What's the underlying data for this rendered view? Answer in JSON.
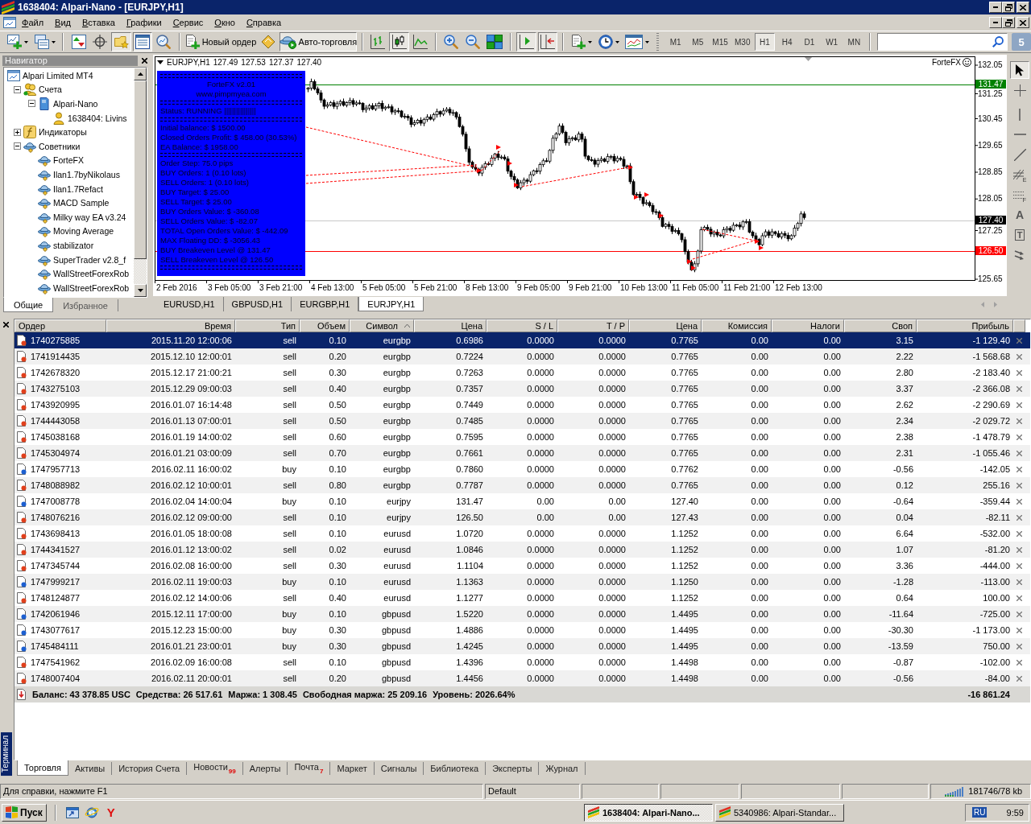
{
  "window": {
    "title": "1638404: Alpari-Nano - [EURJPY,H1]"
  },
  "menu": [
    "Файл",
    "Вид",
    "Вставка",
    "Графики",
    "Сервис",
    "Окно",
    "Справка"
  ],
  "toolbar": {
    "groups": [
      [
        {
          "kind": "newchart",
          "pressed": false
        },
        {
          "kind": "profiles",
          "pressed": false
        }
      ],
      [
        {
          "kind": "marketwatch",
          "pressed": false
        },
        {
          "kind": "datawindow",
          "pressed": false
        },
        {
          "kind": "navigator",
          "pressed": true
        },
        {
          "kind": "terminal",
          "pressed": true
        },
        {
          "kind": "tester",
          "pressed": false
        }
      ],
      [
        {
          "kind": "neworder",
          "label": "Новый ордер",
          "pressed": false
        },
        {
          "kind": "metaeditor",
          "pressed": false
        },
        {
          "kind": "autotrading",
          "label": "Авто-торговля",
          "pressed": true
        }
      ],
      [
        {
          "kind": "barchart",
          "pressed": false
        },
        {
          "kind": "candles",
          "pressed": true
        },
        {
          "kind": "linechart",
          "pressed": false
        }
      ],
      [
        {
          "kind": "zoomin",
          "pressed": false
        },
        {
          "kind": "zoomout",
          "pressed": false
        },
        {
          "kind": "tile",
          "pressed": false
        }
      ],
      [
        {
          "kind": "autoscroll",
          "pressed": true
        },
        {
          "kind": "chartshift",
          "pressed": true
        }
      ],
      [
        {
          "kind": "indicators",
          "pressed": false
        },
        {
          "kind": "periods",
          "pressed": false
        },
        {
          "kind": "templates",
          "pressed": false
        }
      ]
    ],
    "timeframes": [
      {
        "label": "M1",
        "selected": false
      },
      {
        "label": "M5",
        "selected": false
      },
      {
        "label": "M15",
        "selected": false
      },
      {
        "label": "M30",
        "selected": false
      },
      {
        "label": "H1",
        "selected": true
      },
      {
        "label": "H4",
        "selected": false
      },
      {
        "label": "D1",
        "selected": false
      },
      {
        "label": "W1",
        "selected": false
      },
      {
        "label": "MN",
        "selected": false
      }
    ],
    "notifications": "5"
  },
  "navigator": {
    "title": "Навигатор",
    "tree": [
      {
        "label": "Alpari Limited MT4",
        "kind": "terminal",
        "children": [
          {
            "label": "Счета",
            "kind": "accounts",
            "expanded": true,
            "children": [
              {
                "label": "Alpari-Nano",
                "kind": "server",
                "expanded": true,
                "children": [
                  {
                    "label": "1638404: Livins",
                    "kind": "account"
                  }
                ]
              }
            ]
          },
          {
            "label": "Индикаторы",
            "kind": "indicators",
            "expanded": false
          },
          {
            "label": "Советники",
            "kind": "experts",
            "expanded": true,
            "children": [
              {
                "label": "ForteFX",
                "kind": "expert"
              },
              {
                "label": "Ilan1.7byNikolaus",
                "kind": "expert"
              },
              {
                "label": "Ilan1.7Refact",
                "kind": "expert"
              },
              {
                "label": "MACD Sample",
                "kind": "expert"
              },
              {
                "label": "Milky way EA v3.24",
                "kind": "expert"
              },
              {
                "label": "Moving Average",
                "kind": "expert"
              },
              {
                "label": "stabilizator",
                "kind": "expert"
              },
              {
                "label": "SuperTrader v2.8_f",
                "kind": "expert"
              },
              {
                "label": "WallStreetForexRob",
                "kind": "expert"
              },
              {
                "label": "WallStreetForexRob",
                "kind": "expert"
              }
            ]
          }
        ]
      }
    ],
    "tabs": [
      {
        "label": "Общие",
        "selected": true
      },
      {
        "label": "Избранное",
        "selected": false
      }
    ]
  },
  "chart": {
    "symbol": "EURJPY,H1",
    "ohlc": [
      "127.49",
      "127.53",
      "127.37",
      "127.40"
    ],
    "expert": "ForteFX",
    "price_axis": [
      "132.05",
      "131.25",
      "130.45",
      "129.65",
      "128.85",
      "128.05",
      "127.25",
      "125.65"
    ],
    "price_lines": [
      {
        "label": "131.47",
        "kind": "buy",
        "color": "#008000"
      },
      {
        "label": "127.40",
        "kind": "bid",
        "color": "#000000"
      },
      {
        "label": "126.50",
        "kind": "sell",
        "color": "#ff0000"
      }
    ],
    "time_axis": [
      "2 Feb 2016",
      "3 Feb 05:00",
      "3 Feb 21:00",
      "4 Feb 13:00",
      "5 Feb 05:00",
      "5 Feb 21:00",
      "8 Feb 13:00",
      "9 Feb 05:00",
      "9 Feb 21:00",
      "10 Feb 13:00",
      "11 Feb 05:00",
      "11 Feb 21:00",
      "12 Feb 13:00"
    ],
    "ea_panel": {
      "sections": [
        [
          "ForteFX v2.01",
          "www.pimpmyea.com"
        ],
        [
          "Status: RUNNING ||||||||||||||||"
        ],
        [
          "Initial balance: $ 1500.00",
          "Closed Orders Profit: $ 458.00 (30.53%)",
          "EA Balance: $ 1958.00"
        ],
        [
          "Order Step: 75.0 pips",
          "BUY Orders: 1 (0.10 lots)",
          "SELL Orders: 1 (0.10 lots)",
          "BUY Target: $ 25.00",
          "SELL Target: $ 25.00",
          "BUY Orders Value: $ -360.08",
          "SELL Orders Value: $ -82.07",
          "TOTAL Open Orders Value: $ -442.09",
          "MAX Floating DD: $ -3056.43",
          "BUY Breakeven Level @ 131.47",
          "SELL Breakeven Level @ 126.50"
        ]
      ]
    }
  },
  "chart_tabs": [
    {
      "label": "EURUSD,H1",
      "selected": false
    },
    {
      "label": "GBPUSD,H1",
      "selected": false
    },
    {
      "label": "EURGBP,H1",
      "selected": false
    },
    {
      "label": "EURJPY,H1",
      "selected": true
    }
  ],
  "chart_tools": [
    {
      "kind": "cursor",
      "pressed": true
    },
    {
      "kind": "crosshair",
      "pressed": false
    },
    {
      "kind": "vline",
      "pressed": false
    },
    {
      "kind": "hline",
      "pressed": false
    },
    {
      "kind": "trendline",
      "pressed": false
    },
    {
      "kind": "channel",
      "pressed": false,
      "glyph": "E"
    },
    {
      "kind": "fibo",
      "pressed": false,
      "glyph": "F"
    },
    {
      "kind": "text",
      "pressed": false,
      "glyph": "A"
    },
    {
      "kind": "label",
      "pressed": false,
      "glyph": "T"
    },
    {
      "kind": "arrows",
      "pressed": false
    }
  ],
  "terminal": {
    "label": "Терминал",
    "columns": [
      {
        "label": "Ордер",
        "sorted": false
      },
      {
        "label": "Время",
        "sorted": false
      },
      {
        "label": "Тип",
        "sorted": false
      },
      {
        "label": "Объем",
        "sorted": false
      },
      {
        "label": "Символ",
        "sorted": true
      },
      {
        "label": "Цена",
        "sorted": false
      },
      {
        "label": "S / L",
        "sorted": false
      },
      {
        "label": "T / P",
        "sorted": false
      },
      {
        "label": "Цена",
        "sorted": false
      },
      {
        "label": "Комиссия",
        "sorted": false
      },
      {
        "label": "Налоги",
        "sorted": false
      },
      {
        "label": "Своп",
        "sorted": false
      },
      {
        "label": "Прибыль",
        "sorted": false
      }
    ],
    "rows": [
      {
        "cells": [
          "1740275885",
          "2015.11.20 12:00:06",
          "sell",
          "0.10",
          "eurgbp",
          "0.6986",
          "0.0000",
          "0.0000",
          "0.7765",
          "0.00",
          "0.00",
          "3.15",
          "-1 129.40"
        ],
        "kind": "sell",
        "selected": true
      },
      {
        "cells": [
          "1741914435",
          "2015.12.10 12:00:01",
          "sell",
          "0.20",
          "eurgbp",
          "0.7224",
          "0.0000",
          "0.0000",
          "0.7765",
          "0.00",
          "0.00",
          "2.22",
          "-1 568.68"
        ],
        "kind": "sell",
        "selected": false
      },
      {
        "cells": [
          "1742678320",
          "2015.12.17 21:00:21",
          "sell",
          "0.30",
          "eurgbp",
          "0.7263",
          "0.0000",
          "0.0000",
          "0.7765",
          "0.00",
          "0.00",
          "2.80",
          "-2 183.40"
        ],
        "kind": "sell",
        "selected": false
      },
      {
        "cells": [
          "1743275103",
          "2015.12.29 09:00:03",
          "sell",
          "0.40",
          "eurgbp",
          "0.7357",
          "0.0000",
          "0.0000",
          "0.7765",
          "0.00",
          "0.00",
          "3.37",
          "-2 366.08"
        ],
        "kind": "sell",
        "selected": false
      },
      {
        "cells": [
          "1743920995",
          "2016.01.07 16:14:48",
          "sell",
          "0.50",
          "eurgbp",
          "0.7449",
          "0.0000",
          "0.0000",
          "0.7765",
          "0.00",
          "0.00",
          "2.62",
          "-2 290.69"
        ],
        "kind": "sell",
        "selected": false
      },
      {
        "cells": [
          "1744443058",
          "2016.01.13 07:00:01",
          "sell",
          "0.50",
          "eurgbp",
          "0.7485",
          "0.0000",
          "0.0000",
          "0.7765",
          "0.00",
          "0.00",
          "2.34",
          "-2 029.72"
        ],
        "kind": "sell",
        "selected": false
      },
      {
        "cells": [
          "1745038168",
          "2016.01.19 14:00:02",
          "sell",
          "0.60",
          "eurgbp",
          "0.7595",
          "0.0000",
          "0.0000",
          "0.7765",
          "0.00",
          "0.00",
          "2.38",
          "-1 478.79"
        ],
        "kind": "sell",
        "selected": false
      },
      {
        "cells": [
          "1745304974",
          "2016.01.21 03:00:09",
          "sell",
          "0.70",
          "eurgbp",
          "0.7661",
          "0.0000",
          "0.0000",
          "0.7765",
          "0.00",
          "0.00",
          "2.31",
          "-1 055.46"
        ],
        "kind": "sell",
        "selected": false
      },
      {
        "cells": [
          "1747957713",
          "2016.02.11 16:00:02",
          "buy",
          "0.10",
          "eurgbp",
          "0.7860",
          "0.0000",
          "0.0000",
          "0.7762",
          "0.00",
          "0.00",
          "-0.56",
          "-142.05"
        ],
        "kind": "buy",
        "selected": false
      },
      {
        "cells": [
          "1748088982",
          "2016.02.12 10:00:01",
          "sell",
          "0.80",
          "eurgbp",
          "0.7787",
          "0.0000",
          "0.0000",
          "0.7765",
          "0.00",
          "0.00",
          "0.12",
          "255.16"
        ],
        "kind": "sell",
        "selected": false
      },
      {
        "cells": [
          "1747008778",
          "2016.02.04 14:00:04",
          "buy",
          "0.10",
          "eurjpy",
          "131.47",
          "0.00",
          "0.00",
          "127.40",
          "0.00",
          "0.00",
          "-0.64",
          "-359.44"
        ],
        "kind": "buy",
        "selected": false
      },
      {
        "cells": [
          "1748076216",
          "2016.02.12 09:00:00",
          "sell",
          "0.10",
          "eurjpy",
          "126.50",
          "0.00",
          "0.00",
          "127.43",
          "0.00",
          "0.00",
          "0.04",
          "-82.11"
        ],
        "kind": "sell",
        "selected": false
      },
      {
        "cells": [
          "1743698413",
          "2016.01.05 18:00:08",
          "sell",
          "0.10",
          "eurusd",
          "1.0720",
          "0.0000",
          "0.0000",
          "1.1252",
          "0.00",
          "0.00",
          "6.64",
          "-532.00"
        ],
        "kind": "sell",
        "selected": false
      },
      {
        "cells": [
          "1744341527",
          "2016.01.12 13:00:02",
          "sell",
          "0.02",
          "eurusd",
          "1.0846",
          "0.0000",
          "0.0000",
          "1.1252",
          "0.00",
          "0.00",
          "1.07",
          "-81.20"
        ],
        "kind": "sell",
        "selected": false
      },
      {
        "cells": [
          "1747345744",
          "2016.02.08 16:00:00",
          "sell",
          "0.30",
          "eurusd",
          "1.1104",
          "0.0000",
          "0.0000",
          "1.1252",
          "0.00",
          "0.00",
          "3.36",
          "-444.00"
        ],
        "kind": "sell",
        "selected": false
      },
      {
        "cells": [
          "1747999217",
          "2016.02.11 19:00:03",
          "buy",
          "0.10",
          "eurusd",
          "1.1363",
          "0.0000",
          "0.0000",
          "1.1250",
          "0.00",
          "0.00",
          "-1.28",
          "-113.00"
        ],
        "kind": "buy",
        "selected": false
      },
      {
        "cells": [
          "1748124877",
          "2016.02.12 14:00:06",
          "sell",
          "0.40",
          "eurusd",
          "1.1277",
          "0.0000",
          "0.0000",
          "1.1252",
          "0.00",
          "0.00",
          "0.64",
          "100.00"
        ],
        "kind": "sell",
        "selected": false
      },
      {
        "cells": [
          "1742061946",
          "2015.12.11 17:00:00",
          "buy",
          "0.10",
          "gbpusd",
          "1.5220",
          "0.0000",
          "0.0000",
          "1.4495",
          "0.00",
          "0.00",
          "-11.64",
          "-725.00"
        ],
        "kind": "buy",
        "selected": false
      },
      {
        "cells": [
          "1743077617",
          "2015.12.23 15:00:00",
          "buy",
          "0.30",
          "gbpusd",
          "1.4886",
          "0.0000",
          "0.0000",
          "1.4495",
          "0.00",
          "0.00",
          "-30.30",
          "-1 173.00"
        ],
        "kind": "buy",
        "selected": false
      },
      {
        "cells": [
          "1745484111",
          "2016.01.21 23:00:01",
          "buy",
          "0.30",
          "gbpusd",
          "1.4245",
          "0.0000",
          "0.0000",
          "1.4495",
          "0.00",
          "0.00",
          "-13.59",
          "750.00"
        ],
        "kind": "buy",
        "selected": false
      },
      {
        "cells": [
          "1747541962",
          "2016.02.09 16:00:08",
          "sell",
          "0.10",
          "gbpusd",
          "1.4396",
          "0.0000",
          "0.0000",
          "1.4498",
          "0.00",
          "0.00",
          "-0.87",
          "-102.00"
        ],
        "kind": "sell",
        "selected": false
      },
      {
        "cells": [
          "1748007404",
          "2016.02.11 20:00:01",
          "sell",
          "0.20",
          "gbpusd",
          "1.4456",
          "0.0000",
          "0.0000",
          "1.4498",
          "0.00",
          "0.00",
          "-0.56",
          "-84.00"
        ],
        "kind": "sell",
        "selected": false
      }
    ],
    "summary": [
      "Баланс: 43 378.85 USC",
      "Средства: 26 517.61",
      "Маржа: 1 308.45",
      "Свободная маржа: 25 209.16",
      "Уровень: 2026.64%"
    ],
    "total": "-16 861.24",
    "tabs": [
      {
        "label": "Торговля",
        "selected": true
      },
      {
        "label": "Активы",
        "selected": false
      },
      {
        "label": "История Счета",
        "selected": false
      },
      {
        "label": "Новости",
        "badge": "99",
        "selected": false
      },
      {
        "label": "Алерты",
        "selected": false
      },
      {
        "label": "Почта",
        "badge": "7",
        "selected": false
      },
      {
        "label": "Маркет",
        "selected": false
      },
      {
        "label": "Сигналы",
        "selected": false
      },
      {
        "label": "Библиотека",
        "selected": false
      },
      {
        "label": "Эксперты",
        "selected": false
      },
      {
        "label": "Журнал",
        "selected": false
      }
    ]
  },
  "status_bar": {
    "help": "Для справки, нажмите F1",
    "profile": "Default",
    "traffic": "181746/78 kb"
  },
  "taskbar": {
    "start": "Пуск",
    "quick_launch": [
      {
        "kind": "desktop"
      },
      {
        "kind": "browser"
      },
      {
        "kind": "yandex",
        "glyph": "Y"
      }
    ],
    "tasks": [
      {
        "label": "1638404: Alpari-Nano...",
        "selected": true
      },
      {
        "label": "5340986: Alpari-Standar...",
        "selected": false
      }
    ],
    "language": "RU",
    "clock": "9:59"
  }
}
